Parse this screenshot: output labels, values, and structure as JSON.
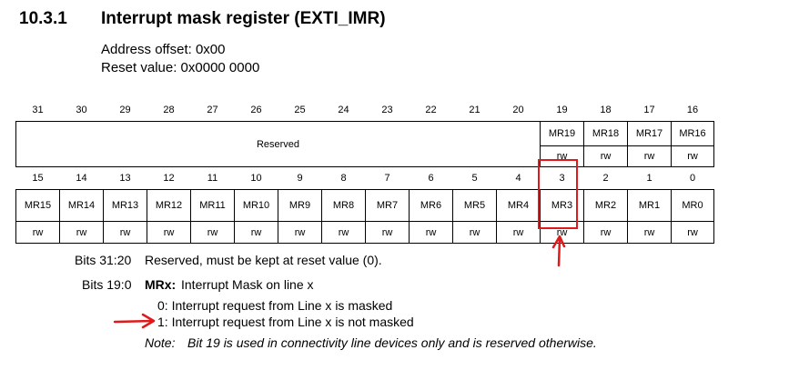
{
  "section": {
    "number": "10.3.1",
    "title": "Interrupt mask register (EXTI_IMR)"
  },
  "address_offset": "Address offset: 0x00",
  "reset_value": "Reset value: 0x0000 0000",
  "register": {
    "upper_bits": [
      "31",
      "30",
      "29",
      "28",
      "27",
      "26",
      "25",
      "24",
      "23",
      "22",
      "21",
      "20",
      "19",
      "18",
      "17",
      "16"
    ],
    "reserved_label": "Reserved",
    "upper_fields": [
      "MR19",
      "MR18",
      "MR17",
      "MR16"
    ],
    "upper_access": [
      "rw",
      "rw",
      "rw",
      "rw"
    ],
    "lower_bits": [
      "15",
      "14",
      "13",
      "12",
      "11",
      "10",
      "9",
      "8",
      "7",
      "6",
      "5",
      "4",
      "3",
      "2",
      "1",
      "0"
    ],
    "lower_fields": [
      "MR15",
      "MR14",
      "MR13",
      "MR12",
      "MR11",
      "MR10",
      "MR9",
      "MR8",
      "MR7",
      "MR6",
      "MR5",
      "MR4",
      "MR3",
      "MR2",
      "MR1",
      "MR0"
    ],
    "lower_access": [
      "rw",
      "rw",
      "rw",
      "rw",
      "rw",
      "rw",
      "rw",
      "rw",
      "rw",
      "rw",
      "rw",
      "rw",
      "rw",
      "rw",
      "rw",
      "rw"
    ]
  },
  "descriptions": {
    "bits_31_20_label": "Bits 31:20",
    "bits_31_20_text": "Reserved, must be kept at reset value (0).",
    "bits_19_0_label": "Bits 19:0",
    "bits_19_0_field": "MRx:",
    "bits_19_0_text": "Interrupt Mask on line x",
    "value_0": "0: Interrupt request from Line x is masked",
    "value_1": "1: Interrupt request from Line x is not masked",
    "note_label": "Note:",
    "note_text": "Bit 19 is used in connectivity line devices only and is reserved otherwise."
  },
  "annotation_color": "#e0191b"
}
